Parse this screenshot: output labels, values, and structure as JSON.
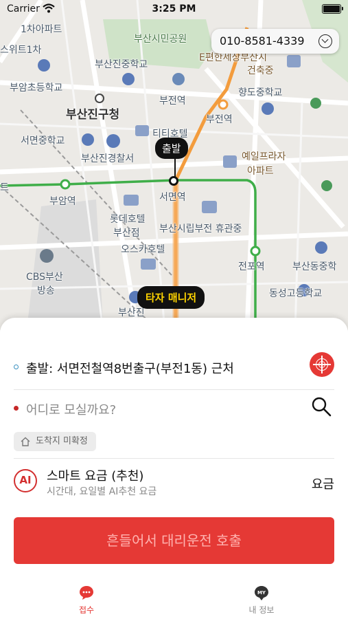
{
  "status_bar": {
    "carrier": "Carrier",
    "time": "3:25 PM"
  },
  "phone_selector": {
    "number": "010-8581-4339"
  },
  "map": {
    "labels": {
      "l1": "1차아파트",
      "l2": "부산시민공원",
      "l3": "스위트1차",
      "l4": "부산진중학교",
      "l5": "E편한세상부산시",
      "l6": "건축중",
      "l7": "부암초등학교",
      "l8": "향도중학교",
      "l9": "부전역",
      "l10": "부산진구청",
      "l11": "부전역",
      "l12": "티티호텔",
      "l13": "서면중학교",
      "l14": "부산진경찰서",
      "l15": "예일프라자",
      "l16": "아파트",
      "l17": "부암역",
      "l18": "서면역",
      "l19": "롯데호텔",
      "l20": "부산점",
      "l21": "부산시립부전 휴관중",
      "l22": "오스카호텔",
      "l23": "전포역",
      "l24": "부산동중학",
      "l25": "CBS부산",
      "l26": "방송",
      "l27": "동성고등학교",
      "l28": "부산진",
      "l29": "트"
    },
    "start_pin": "출발",
    "driver_pin": "타자 매니저"
  },
  "sheet": {
    "start_text": "출발: 서면전철역8번출구(부전1동) 근처",
    "dest_placeholder": "어디로 모실까요?",
    "dest_chip": "도착지 미확정",
    "fare": {
      "badge": "AI",
      "title": "스마트 요금 (추천)",
      "subtitle": "시간대, 요일별 AI추천 요금",
      "right_label": "요금"
    },
    "call_button": "흔들어서 대리운전 호출"
  },
  "tabs": [
    {
      "label": "접수",
      "icon": "chat-bubble-icon",
      "active": true
    },
    {
      "label": "내 정보",
      "icon": "my-info-icon",
      "active": false
    }
  ],
  "colors": {
    "accent": "#e53935",
    "driver_text": "#ffd400",
    "subway_green": "#3fae49",
    "road_orange": "#f39c3d"
  }
}
